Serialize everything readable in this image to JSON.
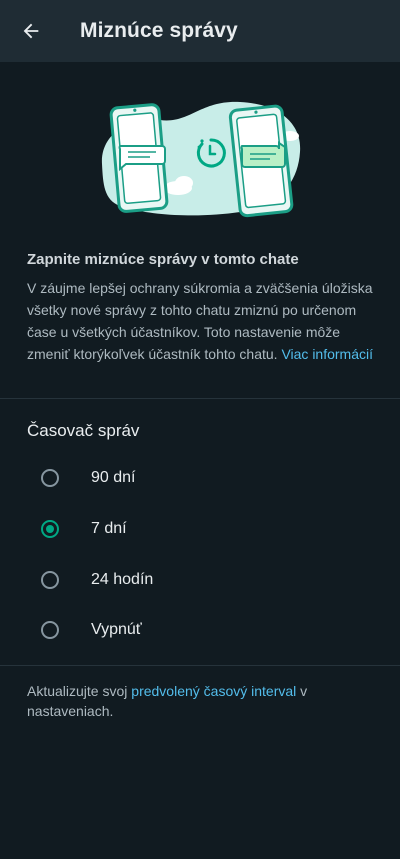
{
  "header": {
    "back_icon": "arrow-left-icon",
    "title": "Miznúce správy"
  },
  "illustration": {
    "icons": [
      "phone-icon",
      "timer-icon",
      "message-bubble-icon",
      "cloud-icon"
    ],
    "colors": {
      "blob": "#c8ede8",
      "phone_outline": "#1b9e86",
      "accent": "#00a884"
    }
  },
  "description": {
    "heading": "Zapnite miznúce správy v tomto chate",
    "body": "V záujme lepšej ochrany súkromia a zväčšenia úložiska všetky nové správy z tohto chatu zmiznú po určenom čase u všetkých účastníkov. Toto nastavenie môže zmeniť ktorýkoľvek účastník tohto chatu. ",
    "link": "Viac informácií"
  },
  "timer": {
    "title": "Časovač správ",
    "options": [
      {
        "label": "90 dní",
        "selected": false
      },
      {
        "label": "7 dní",
        "selected": true
      },
      {
        "label": "24 hodín",
        "selected": false
      },
      {
        "label": "Vypnúť",
        "selected": false
      }
    ]
  },
  "footer": {
    "prefix": "Aktualizujte svoj ",
    "link": "predvolený časový interval",
    "suffix": " v nastaveniach."
  },
  "colors": {
    "background": "#111b21",
    "header": "#1f2c34",
    "accent": "#00a884",
    "link": "#53bdeb"
  }
}
